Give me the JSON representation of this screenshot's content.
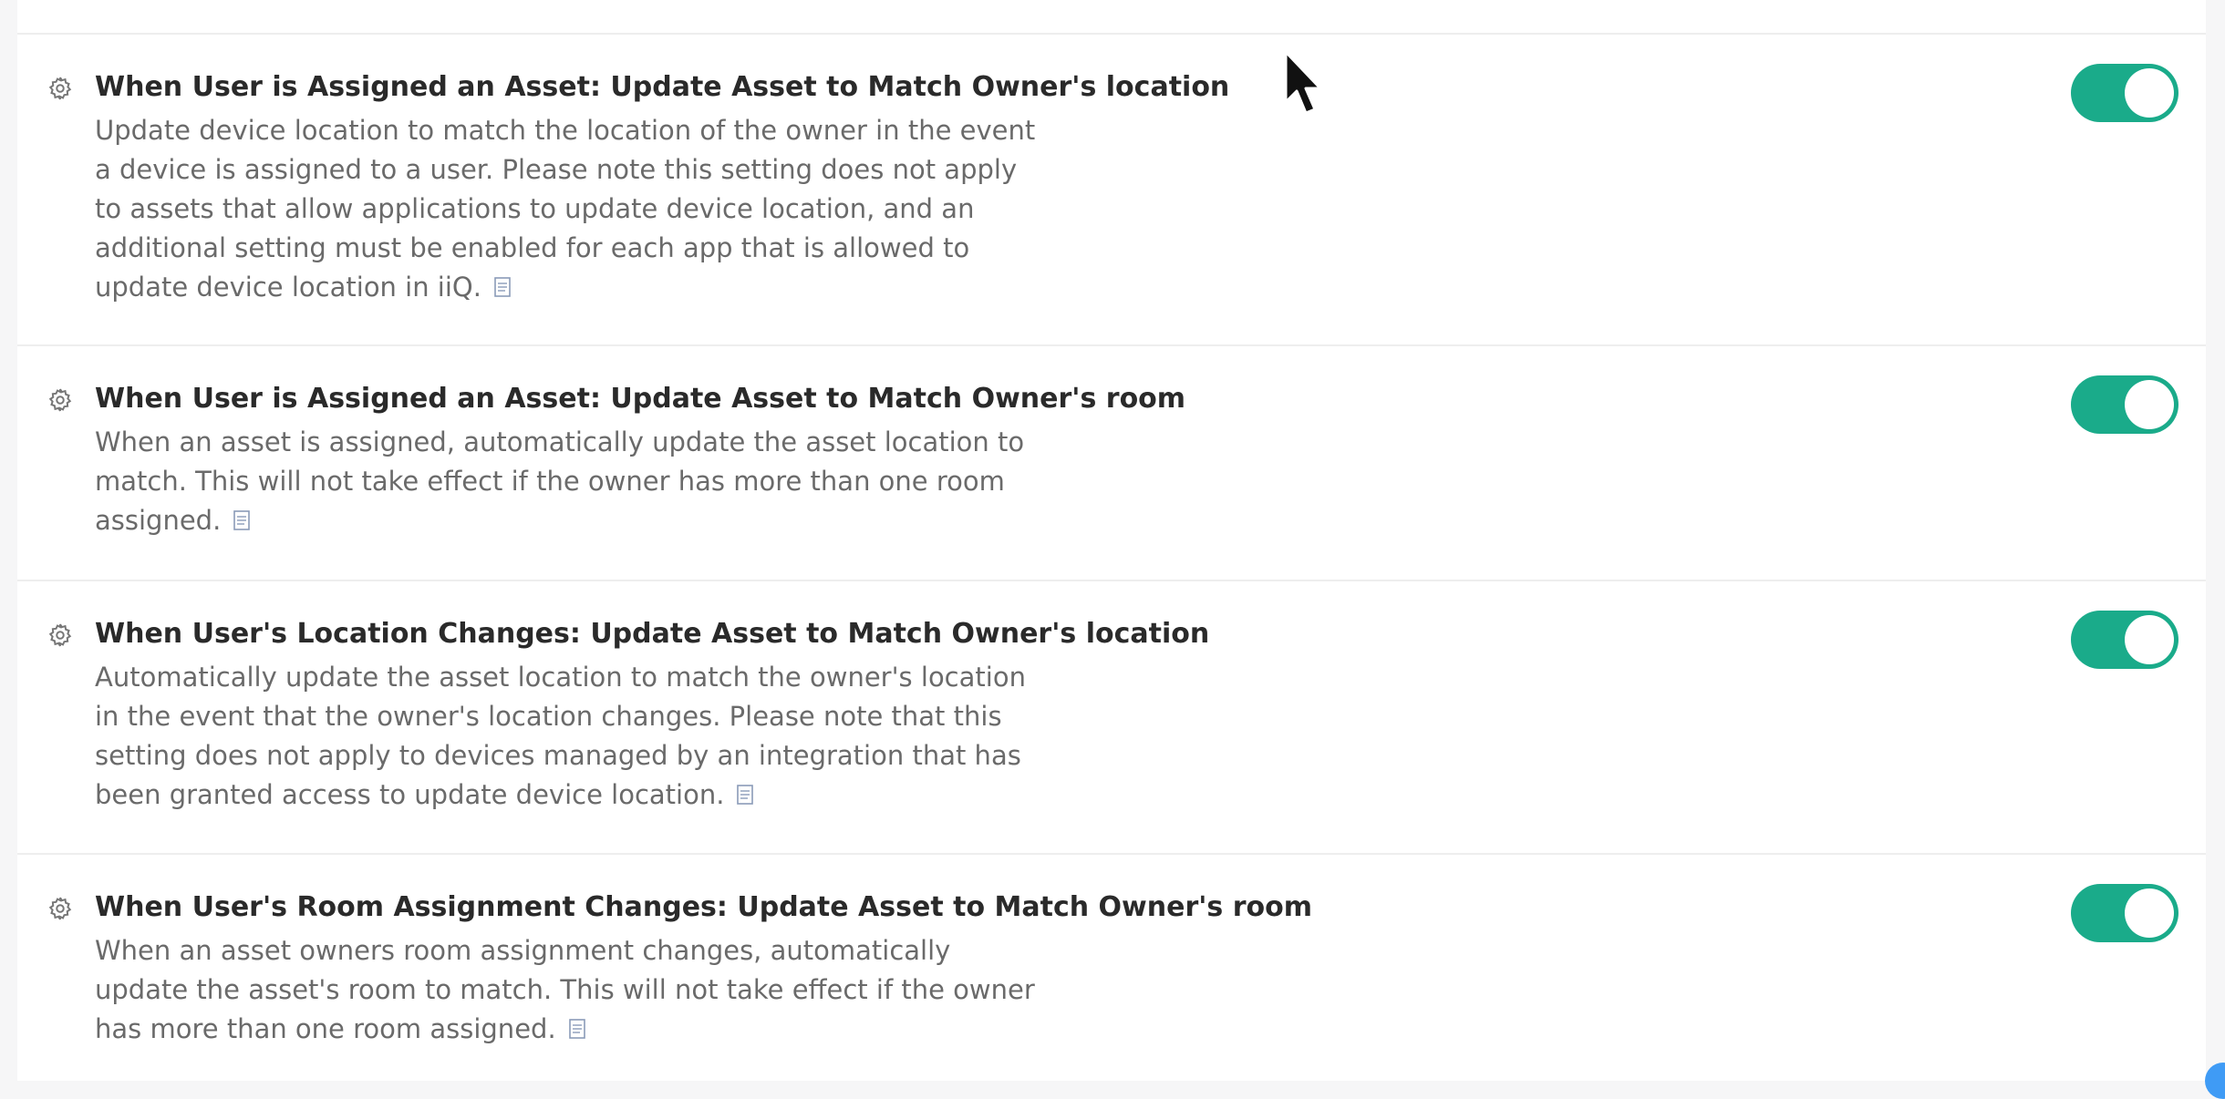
{
  "settings": [
    {
      "title": "When User is Assigned an Asset: Update Asset to Match Owner's location",
      "description": "Update device location to match the location of the owner in the event a device is assigned to a user. Please note this setting does not apply to assets that allow applications to update device location, and an additional setting must be enabled for each app that is allowed to update device location in iiQ.",
      "enabled": true
    },
    {
      "title": "When User is Assigned an Asset: Update Asset to Match Owner's room",
      "description": "When an asset is assigned, automatically update the asset location to match. This will not take effect if the owner has more than one room assigned.",
      "enabled": true
    },
    {
      "title": "When User's Location Changes: Update Asset to Match Owner's location",
      "description": "Automatically update the asset location to match the owner's location in the event that the owner's location changes. Please note that this setting does not apply to devices managed by an integration that has been granted access to update device location.",
      "enabled": true
    },
    {
      "title": "When User's Room Assignment Changes: Update Asset to Match Owner's room",
      "description": "When an asset owners room assignment changes, automatically update the asset's room to match. This will not take effect if the owner has more than one room assigned.",
      "enabled": true
    }
  ],
  "icons": {
    "setting_icon": "gear-icon",
    "description_icon": "note-icon"
  },
  "colors": {
    "toggle_on": "#1aab8a",
    "title_text": "#2a2a2a",
    "description_text": "#6a6a6a",
    "divider": "#eeeeee"
  }
}
